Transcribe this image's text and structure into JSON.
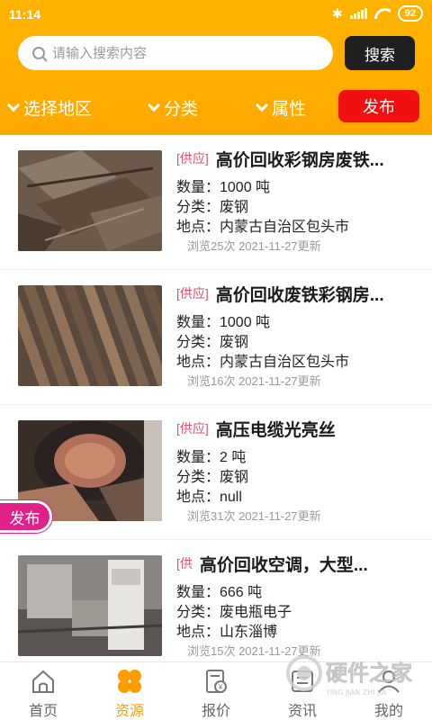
{
  "status_bar": {
    "time": "11:14",
    "battery": "92"
  },
  "search": {
    "placeholder": "请输入搜索内容",
    "button_label": "搜索"
  },
  "filters": [
    {
      "label": "选择地区"
    },
    {
      "label": "分类"
    },
    {
      "label": "属性"
    }
  ],
  "publish_button": "发布",
  "float_publish": "发布",
  "listings": [
    {
      "tag": "[供应]",
      "title": "高价回收彩钢房废铁...",
      "quantity": "数量：1000 吨",
      "category": "分类：废钢",
      "location": "地点：内蒙古自治区包头市",
      "stats": "浏览25次 2021-11-27更新"
    },
    {
      "tag": "[供应]",
      "title": "高价回收废铁彩钢房...",
      "quantity": "数量：1000 吨",
      "category": "分类：废钢",
      "location": "地点：内蒙古自治区包头市",
      "stats": "浏览16次 2021-11-27更新"
    },
    {
      "tag": "[供应]",
      "title": "高压电缆光亮丝",
      "quantity": "数量：2 吨",
      "category": "分类：废钢",
      "location": "地点：null",
      "stats": "浏览31次 2021-11-27更新"
    },
    {
      "tag": "[供",
      "title": "高价回收空调，大型...",
      "quantity": "数量：666 吨",
      "category": "分类：废电瓶电子",
      "location": "地点：山东淄博",
      "stats": "浏览15次 2021-11-27更新"
    }
  ],
  "tabs": [
    {
      "label": "首页",
      "icon": "home-icon"
    },
    {
      "label": "资源",
      "icon": "resource-icon"
    },
    {
      "label": "报价",
      "icon": "price-icon"
    },
    {
      "label": "资讯",
      "icon": "news-icon"
    },
    {
      "label": "我的",
      "icon": "profile-icon"
    }
  ],
  "watermark": {
    "text": "硬件之家",
    "subtext": "YING JIAN ZHI JIA"
  },
  "colors": {
    "header": "#ffb400",
    "publish": "#f01010",
    "accent_tab": "#ff9d00",
    "tag": "#e0506a",
    "float_publish": "#e2208a"
  }
}
